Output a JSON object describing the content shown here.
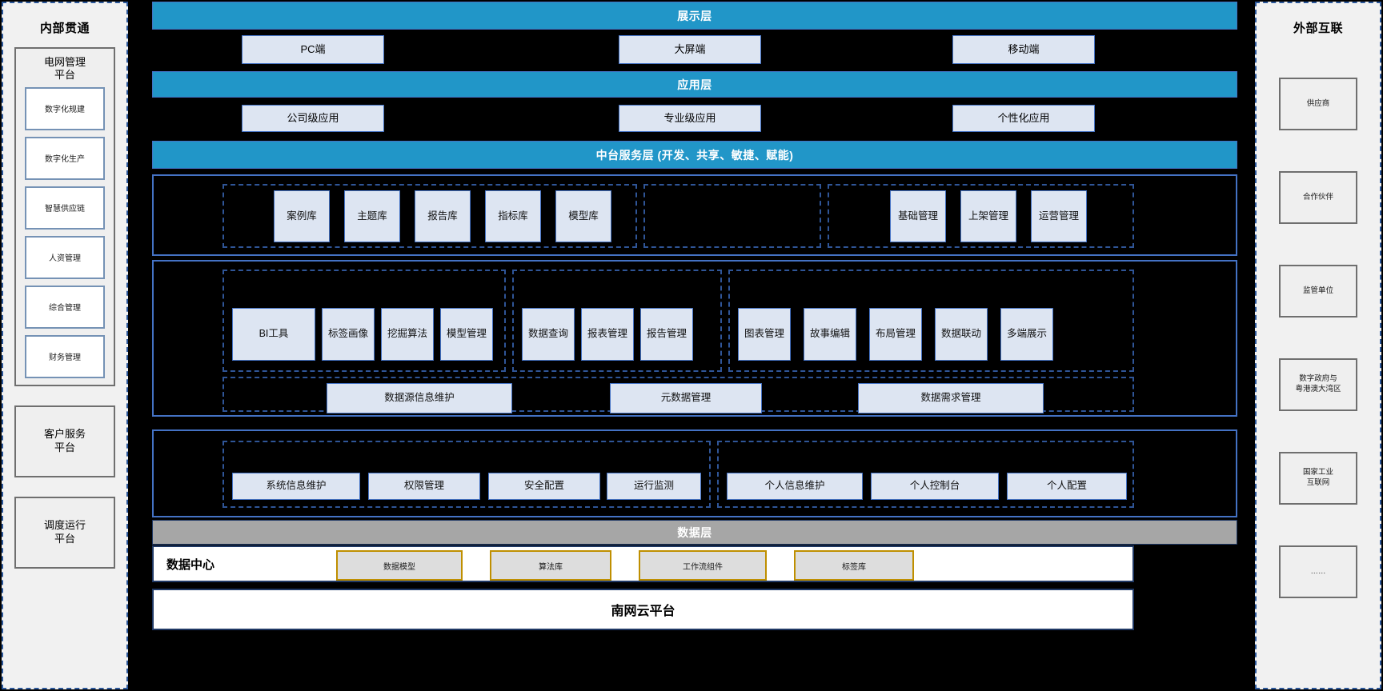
{
  "left_rail": {
    "title": "内部贯通",
    "platforms": [
      {
        "name": "电网管理\n平台",
        "items": [
          "数字化规建",
          "数字化生产",
          "智慧供应链",
          "人资管理",
          "综合管理",
          "财务管理"
        ]
      }
    ],
    "plain_platforms": [
      "客户服务\n平台",
      "调度运行\n平台"
    ]
  },
  "right_rail": {
    "title": "外部互联",
    "items": [
      "供应商",
      "合作伙伴",
      "监管单位",
      "数字政府与\n粤港澳大湾区",
      "国家工业\n互联网",
      "……"
    ]
  },
  "layers": {
    "presentation": "展示层",
    "application": "应用层",
    "middle_platform": "中台服务层 (开发、共享、敏捷、赋能)",
    "data": "数据层"
  },
  "presentation_clients": [
    "PC端",
    "大屏端",
    "移动端"
  ],
  "application_apps": [
    "公司级应用",
    "专业级应用",
    "个性化应用"
  ],
  "panel_assets": {
    "group_a": [
      "案例库",
      "主题库",
      "报告库",
      "指标库",
      "模型库"
    ],
    "group_b": [],
    "group_c": [
      "基础管理",
      "上架管理",
      "运营管理"
    ]
  },
  "panel_tools": {
    "group_a": [
      "BI工具",
      "标签画像",
      "挖掘算法",
      "模型管理"
    ],
    "group_b": [
      "数据查询",
      "报表管理",
      "报告管理"
    ],
    "group_c": [
      "图表管理",
      "故事编辑",
      "布局管理",
      "数据联动",
      "多端展示"
    ],
    "group_d": [
      "数据源信息维护",
      "元数据管理",
      "数据需求管理"
    ]
  },
  "panel_admin": {
    "group_a": [
      "系统信息维护",
      "权限管理",
      "安全配置",
      "运行监测"
    ],
    "group_b": [
      "个人信息维护",
      "个人控制台",
      "个人配置"
    ]
  },
  "data_center": {
    "label": "数据中心",
    "items": [
      "数据模型",
      "算法库",
      "工作流组件",
      "标签库"
    ]
  },
  "cloud_platform": "南网云平台",
  "colors": {
    "layer_blue": "#2196c8",
    "layer_grey": "#a6a6a6",
    "chip_fill": "#dde5f2",
    "chip_border": "#4472c4",
    "dashed_group": "#2f5597",
    "dc_chip_border": "#bf8f00",
    "rail_bg": "#f1f1f1",
    "rail_border": "#2a5699",
    "background": "#000000"
  }
}
